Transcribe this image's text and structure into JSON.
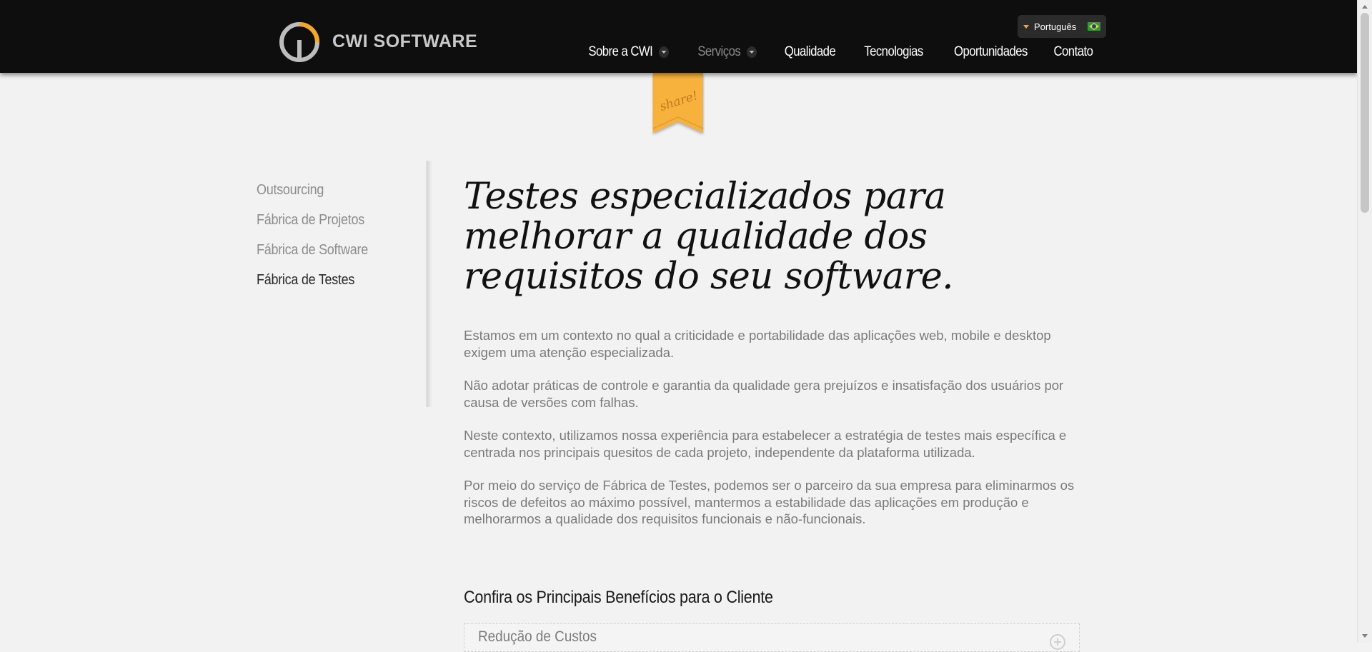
{
  "header": {
    "logo_text": "CWI SOFTWARE",
    "language": {
      "label": "Português",
      "flag": "brazil-flag-icon"
    },
    "nav": [
      {
        "label": "Sobre a CWI",
        "has_dropdown": true,
        "active": false
      },
      {
        "label": "Serviços",
        "has_dropdown": true,
        "active": true
      },
      {
        "label": "Qualidade",
        "has_dropdown": false,
        "active": false
      },
      {
        "label": "Tecnologias",
        "has_dropdown": false,
        "active": false
      },
      {
        "label": "Oportunidades",
        "has_dropdown": false,
        "active": false
      },
      {
        "label": "Contato",
        "has_dropdown": false,
        "active": false
      }
    ]
  },
  "share_ribbon": {
    "label": "share!"
  },
  "sidebar": {
    "items": [
      {
        "label": "Outsourcing",
        "active": false
      },
      {
        "label": "Fábrica de Projetos",
        "active": false
      },
      {
        "label": "Fábrica de Software",
        "active": false
      },
      {
        "label": "Fábrica de Testes",
        "active": true
      }
    ]
  },
  "main": {
    "headline": "Testes especializados para melhorar a qualidade dos requisitos do seu software.",
    "paragraphs": [
      "Estamos em um contexto no qual a criticidade e portabilidade das aplicações web, mobile e desktop exigem uma atenção especializada.",
      "Não adotar práticas de controle e garantia da qualidade gera prejuízos e insatisfação dos usuários por causa de versões com falhas.",
      "Neste contexto, utilizamos nossa experiência para estabelecer a estratégia de testes mais específica e centrada nos principais quesitos de cada projeto, independente da plataforma utilizada.",
      "Por meio do serviço de Fábrica de Testes, podemos ser o parceiro da sua empresa para eliminarmos os riscos de defeitos ao máximo possível, mantermos a estabilidade das aplicações em produção e melhorarmos a qualidade dos requisitos funcionais e não-funcionais."
    ],
    "benefits_title": "Confira os Principais Benefícios para o Cliente",
    "accordion": [
      {
        "label": "Redução de Custos",
        "icon": "plus-circle-icon"
      }
    ]
  },
  "colors": {
    "header_bg": "#0e0e0e",
    "page_bg": "#f2f2f2",
    "accent_orange": "#f7a823",
    "nav_active": "#8a8a8a"
  }
}
